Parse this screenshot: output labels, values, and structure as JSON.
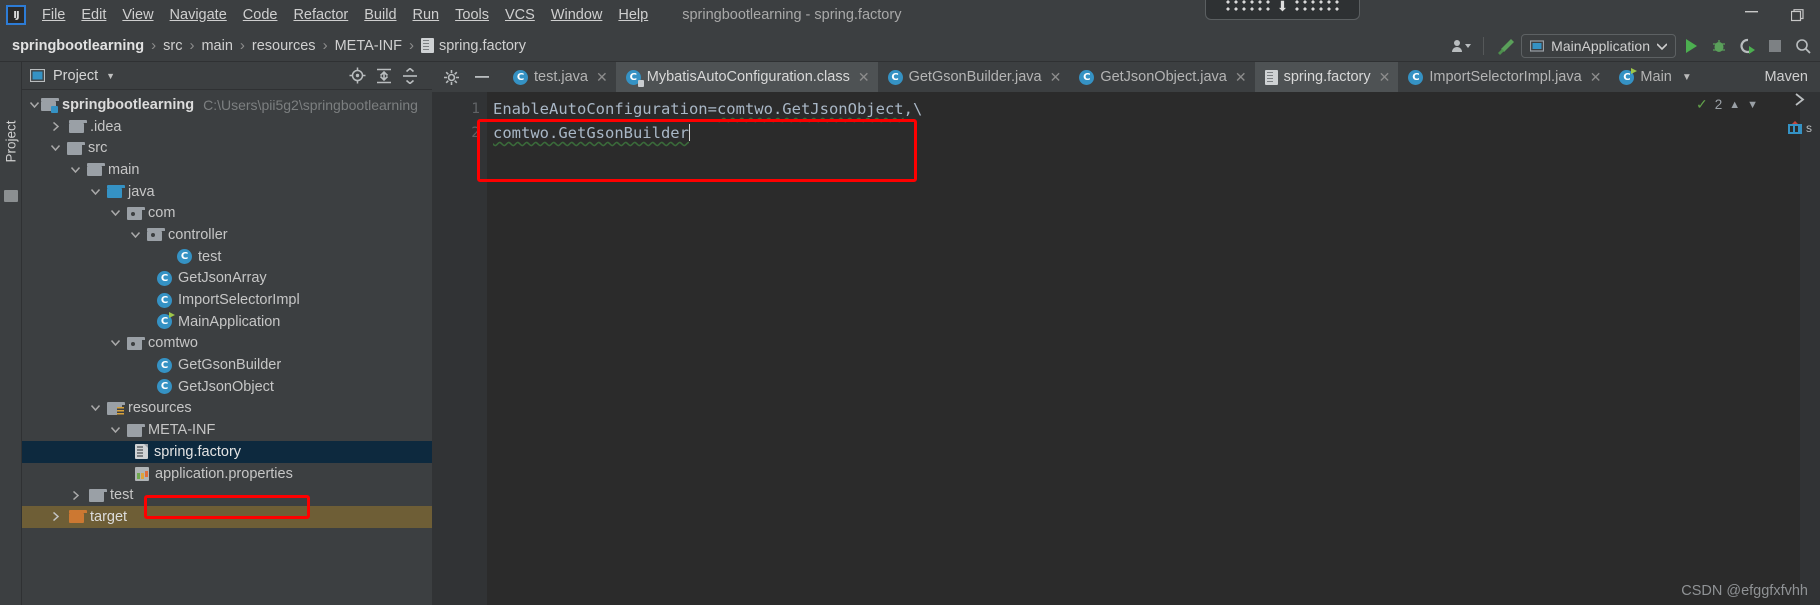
{
  "window": {
    "title": "springbootlearning - spring.factory",
    "logo_text": "IJ",
    "minimize_label": "minimize-icon",
    "restore_label": "restore-icon",
    "ime_indicator": "ime-floating-toolbar"
  },
  "menubar": {
    "items": [
      {
        "label": "File"
      },
      {
        "label": "Edit"
      },
      {
        "label": "View"
      },
      {
        "label": "Navigate"
      },
      {
        "label": "Code"
      },
      {
        "label": "Refactor"
      },
      {
        "label": "Build"
      },
      {
        "label": "Run"
      },
      {
        "label": "Tools"
      },
      {
        "label": "VCS"
      },
      {
        "label": "Window"
      },
      {
        "label": "Help"
      }
    ]
  },
  "breadcrumb": {
    "items": [
      {
        "label": "springbootlearning"
      },
      {
        "label": "src"
      },
      {
        "label": "main"
      },
      {
        "label": "resources"
      },
      {
        "label": "META-INF"
      },
      {
        "label": "spring.factory"
      }
    ],
    "separator": "›"
  },
  "toolbar": {
    "run_config": "MainApplication",
    "icons": [
      "user-settings-icon",
      "build-hammer-icon",
      "run-icon",
      "debug-icon",
      "run-coverage-icon",
      "stop-icon",
      "search-icon"
    ]
  },
  "project_panel": {
    "tool_tab": "Project",
    "title": "Project",
    "header_icons": [
      "locate-icon",
      "expand-all-icon",
      "collapse-all-icon"
    ],
    "tree": [
      {
        "label": "springbootlearning",
        "path": "C:\\Users\\pii5g2\\springbootlearning",
        "icon": "module-folder-icon",
        "indent": 0,
        "arrow": "down",
        "bold": true
      },
      {
        "label": ".idea",
        "icon": "folder-icon",
        "indent": 1,
        "arrow": "right"
      },
      {
        "label": "src",
        "icon": "folder-icon",
        "indent": 1,
        "arrow": "down"
      },
      {
        "label": "main",
        "icon": "folder-icon",
        "indent": 2,
        "arrow": "down"
      },
      {
        "label": "java",
        "icon": "source-folder-icon",
        "indent": 3,
        "arrow": "down"
      },
      {
        "label": "com",
        "icon": "package-folder-icon",
        "indent": 4,
        "arrow": "down"
      },
      {
        "label": "controller",
        "icon": "package-folder-icon",
        "indent": 5,
        "arrow": "down"
      },
      {
        "label": "test",
        "icon": "java-class-icon",
        "indent": 7,
        "arrow": "none"
      },
      {
        "label": "GetJsonArray",
        "icon": "java-class-icon",
        "indent": 6,
        "arrow": "none"
      },
      {
        "label": "ImportSelectorImpl",
        "icon": "java-class-icon",
        "indent": 6,
        "arrow": "none"
      },
      {
        "label": "MainApplication",
        "icon": "java-class-runnable-icon",
        "indent": 6,
        "arrow": "none"
      },
      {
        "label": "comtwo",
        "icon": "package-folder-icon",
        "indent": 4,
        "arrow": "down"
      },
      {
        "label": "GetGsonBuilder",
        "icon": "java-class-icon",
        "indent": 6,
        "arrow": "none"
      },
      {
        "label": "GetJsonObject",
        "icon": "java-class-icon",
        "indent": 6,
        "arrow": "none"
      },
      {
        "label": "resources",
        "icon": "resources-folder-icon",
        "indent": 3,
        "arrow": "down"
      },
      {
        "label": "META-INF",
        "icon": "folder-icon",
        "indent": 4,
        "arrow": "down"
      },
      {
        "label": "spring.factory",
        "icon": "file-icon",
        "indent": 6,
        "arrow": "none",
        "state": "selected"
      },
      {
        "label": "application.properties",
        "icon": "properties-file-icon",
        "indent": 6,
        "arrow": "none"
      },
      {
        "label": "test",
        "icon": "folder-icon",
        "indent": 2,
        "arrow": "right"
      },
      {
        "label": "target",
        "icon": "excluded-folder-icon",
        "indent": 1,
        "arrow": "right",
        "state": "highlighted"
      }
    ]
  },
  "editor": {
    "tab_tools": [
      "gear-icon",
      "hide-icon"
    ],
    "tabs": [
      {
        "label": "test.java",
        "icon": "java-class-icon",
        "active": false,
        "closable": true
      },
      {
        "label": "MybatisAutoConfiguration.class",
        "icon": "java-class-locked-icon",
        "active": true,
        "closable": true
      },
      {
        "label": "GetGsonBuilder.java",
        "icon": "java-class-icon",
        "active": false,
        "closable": true
      },
      {
        "label": "GetJsonObject.java",
        "icon": "java-class-icon",
        "active": false,
        "closable": true
      },
      {
        "label": "spring.factory",
        "icon": "file-icon",
        "active": true,
        "closable": true,
        "current": true
      },
      {
        "label": "ImportSelectorImpl.java",
        "icon": "java-class-icon",
        "active": false,
        "closable": true
      },
      {
        "label": "Main",
        "icon": "java-class-runnable-icon",
        "active": false,
        "closable": false,
        "chevron": true
      }
    ],
    "maven_tab": "Maven",
    "line_numbers": [
      "1",
      "2"
    ],
    "lines": [
      [
        {
          "text": "EnableAutoConfiguration=",
          "style": "plain"
        },
        {
          "text": "comtwo.GetJsonObject",
          "style": "warn"
        },
        {
          "text": ",\\",
          "style": "plain"
        }
      ],
      [
        {
          "text": "comtwo.GetGsonBuilder",
          "style": "warn"
        }
      ]
    ],
    "inspection_count": "2",
    "inspection_icon": "inspection-ok-icon"
  },
  "right_strip": {
    "icons": [
      "expand-right-icon",
      "maven-icon"
    ],
    "maven_label": "s"
  },
  "watermark": "CSDN @efggfxfvhh",
  "colors": {
    "accent_red": "#fe0000",
    "selection_blue": "#0d293e",
    "target_highlight": "#6e5e36",
    "editor_bg": "#2b2b2b",
    "panel_bg": "#3c3f41",
    "class_icon": "#3592c4",
    "run_green": "#62a24a"
  }
}
